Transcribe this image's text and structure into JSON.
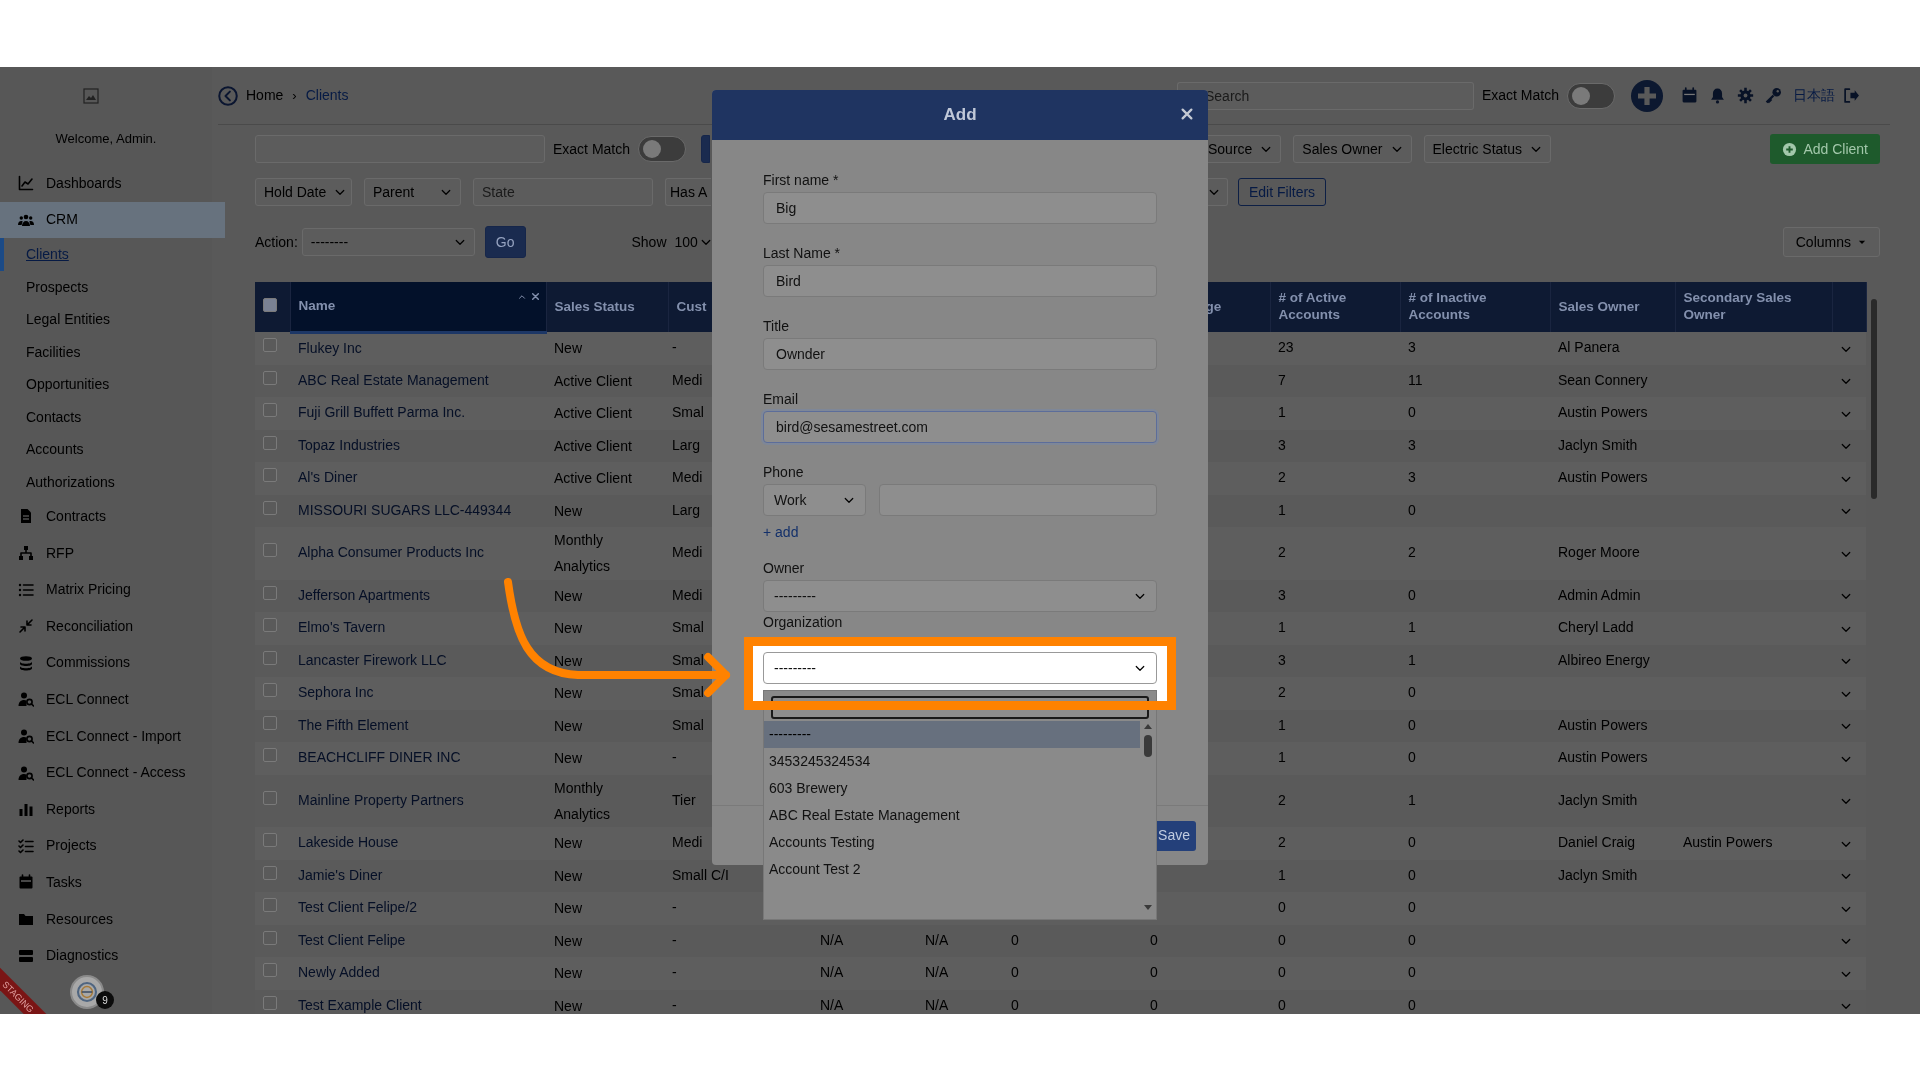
{
  "sidebar": {
    "welcome": "Welcome, Admin.",
    "items": [
      {
        "label": "Dashboards",
        "selected": false
      },
      {
        "label": "CRM",
        "selected": true,
        "children": [
          {
            "label": "Clients",
            "selected": true
          },
          {
            "label": "Prospects",
            "selected": false
          },
          {
            "label": "Legal Entities",
            "selected": false
          },
          {
            "label": "Facilities",
            "selected": false
          },
          {
            "label": "Opportunities",
            "selected": false
          },
          {
            "label": "Contacts",
            "selected": false
          },
          {
            "label": "Accounts",
            "selected": false
          },
          {
            "label": "Authorizations",
            "selected": false
          }
        ]
      },
      {
        "label": "Contracts",
        "selected": false
      },
      {
        "label": "RFP",
        "selected": false
      },
      {
        "label": "Matrix Pricing",
        "selected": false
      },
      {
        "label": "Reconciliation",
        "selected": false
      },
      {
        "label": "Commissions",
        "selected": false
      },
      {
        "label": "ECL Connect",
        "selected": false
      },
      {
        "label": "ECL Connect - Import",
        "selected": false
      },
      {
        "label": "ECL Connect - Access",
        "selected": false
      },
      {
        "label": "Reports",
        "selected": false
      },
      {
        "label": "Projects",
        "selected": false
      },
      {
        "label": "Tasks",
        "selected": false
      },
      {
        "label": "Resources",
        "selected": false
      },
      {
        "label": "Diagnostics",
        "selected": false
      }
    ],
    "widget_badge": "9",
    "ribbon": "STAGING"
  },
  "breadcrumb": {
    "items": [
      "Home",
      "Clients"
    ],
    "separator": "›"
  },
  "topbar": {
    "search_placeholder": "Search",
    "exact_match": {
      "label": "Exact Match",
      "on": false
    },
    "language": "日本語"
  },
  "filters": {
    "exact_match": {
      "label": "Exact Match",
      "on": false
    },
    "selects": [
      "Source",
      "Sales Owner",
      "Electric Status"
    ],
    "add_button": "Add Client",
    "row2_selects": [
      "Hold Date",
      "Parent"
    ],
    "state_placeholder": "State",
    "has_select": "Has A",
    "edit_filters": "Edit Filters",
    "action_label": "Action:",
    "action_value": "--------",
    "go": "Go",
    "show_label": "Show",
    "show_value": "100",
    "columns_button": "Columns"
  },
  "table": {
    "all_checked": false,
    "columns": {
      "name": "Name",
      "sales_status": "Sales Status",
      "column_3": "Cust",
      "column_7": "ge",
      "active_accounts": "# of Active Accounts",
      "inactive_accounts": "# of Inactive Accounts",
      "sales_owner": "Sales Owner",
      "secondary_sales_owner": "Secondary Sales Owner"
    },
    "rows": [
      {
        "checked": false,
        "name": "Flukey Inc",
        "sales_status": "New",
        "column_3": "-",
        "active_accounts": "23",
        "inactive_accounts": "3",
        "sales_owner": "Al Panera"
      },
      {
        "checked": false,
        "name": "ABC Real Estate Management",
        "sales_status": "Active Client",
        "column_3": "Medi",
        "active_accounts": "7",
        "inactive_accounts": "11",
        "sales_owner": "Sean Connery"
      },
      {
        "checked": false,
        "name": "Fuji Grill Buffett Parma Inc.",
        "sales_status": "Active Client",
        "column_3": "Smal",
        "active_accounts": "1",
        "inactive_accounts": "0",
        "sales_owner": "Austin Powers"
      },
      {
        "checked": false,
        "name": "Topaz Industries",
        "sales_status": "Active Client",
        "column_3": "Larg",
        "active_accounts": "3",
        "inactive_accounts": "3",
        "sales_owner": "Jaclyn Smith"
      },
      {
        "checked": false,
        "name": "Al's Diner",
        "sales_status": "Active Client",
        "column_3": "Medi",
        "active_accounts": "2",
        "inactive_accounts": "3",
        "sales_owner": "Austin Powers"
      },
      {
        "checked": false,
        "name": "MISSOURI SUGARS LLC-449344",
        "sales_status": "New",
        "column_3": "Larg",
        "active_accounts": "1",
        "inactive_accounts": "0"
      },
      {
        "checked": false,
        "name": "Alpha Consumer Products Inc",
        "sales_status": "Monthly Analytics",
        "column_3": "Medi",
        "active_accounts": "2",
        "inactive_accounts": "2",
        "sales_owner": "Roger Moore"
      },
      {
        "checked": false,
        "name": "Jefferson Apartments",
        "sales_status": "New",
        "column_3": "Medi",
        "active_accounts": "3",
        "inactive_accounts": "0",
        "sales_owner": "Admin Admin"
      },
      {
        "checked": false,
        "name": "Elmo's Tavern",
        "sales_status": "New",
        "column_3": "Smal",
        "active_accounts": "1",
        "inactive_accounts": "1",
        "sales_owner": "Cheryl Ladd"
      },
      {
        "checked": false,
        "name": "Lancaster Firework LLC",
        "sales_status": "New",
        "column_3": "Smal",
        "active_accounts": "3",
        "inactive_accounts": "1",
        "sales_owner": "Albireo Energy"
      },
      {
        "checked": false,
        "name": "Sephora Inc",
        "sales_status": "New",
        "column_3": "Smal",
        "active_accounts": "2",
        "inactive_accounts": "0"
      },
      {
        "checked": false,
        "name": "The Fifth Element",
        "sales_status": "New",
        "column_3": "Smal",
        "active_accounts": "1",
        "inactive_accounts": "0",
        "sales_owner": "Austin Powers"
      },
      {
        "checked": false,
        "name": "BEACHCLIFF DINER INC",
        "sales_status": "New",
        "column_3": "-",
        "active_accounts": "1",
        "inactive_accounts": "0",
        "sales_owner": "Austin Powers"
      },
      {
        "checked": false,
        "name": "Mainline Property Partners",
        "sales_status": "Monthly Analytics",
        "column_3": "Tier",
        "active_accounts": "2",
        "inactive_accounts": "1",
        "sales_owner": "Jaclyn Smith"
      },
      {
        "checked": false,
        "name": "Lakeside House",
        "sales_status": "New",
        "column_3": "Medi",
        "active_accounts": "2",
        "inactive_accounts": "0",
        "sales_owner": "Daniel Craig",
        "secondary_sales_owner": "Austin Powers"
      },
      {
        "checked": false,
        "name": "Jamie's Diner",
        "sales_status": "New",
        "column_3": "Small C/I",
        "active_accounts": "1",
        "inactive_accounts": "0",
        "sales_owner": "Jaclyn Smith"
      },
      {
        "checked": false,
        "name": "Test Client Felipe/2",
        "sales_status": "New",
        "column_3": "-",
        "active_accounts": "0",
        "inactive_accounts": "0"
      },
      {
        "checked": false,
        "name": "Test Client Felipe",
        "sales_status": "New",
        "column_3": "-",
        "column_4": "N/A",
        "column_5": "N/A",
        "column_6": "0",
        "column_7": "0",
        "active_accounts": "0",
        "inactive_accounts": "0"
      },
      {
        "checked": false,
        "name": "Newly Added",
        "sales_status": "New",
        "column_3": "-",
        "column_4": "N/A",
        "column_5": "N/A",
        "column_6": "0",
        "column_7": "0",
        "active_accounts": "0",
        "inactive_accounts": "0"
      },
      {
        "checked": false,
        "name": "Test Example Client",
        "sales_status": "New",
        "column_3": "-",
        "column_4": "N/A",
        "column_5": "N/A",
        "column_6": "0",
        "column_7": "0",
        "active_accounts": "0",
        "inactive_accounts": "0"
      }
    ]
  },
  "modal": {
    "title": "Add",
    "fields": [
      {
        "kind": "input",
        "label": "First name *",
        "value": "Big",
        "focused": false
      },
      {
        "kind": "input",
        "label": "Last Name *",
        "value": "Bird",
        "focused": false
      },
      {
        "kind": "input",
        "label": "Title",
        "value": "Ownder",
        "focused": false
      },
      {
        "kind": "input",
        "label": "Email",
        "value": "bird@sesamestreet.com",
        "focused": true
      },
      {
        "kind": "phone",
        "label": "Phone",
        "type": "Work",
        "add_link": "+ add"
      },
      {
        "kind": "select",
        "label": "Owner",
        "value": "---------",
        "open": false
      },
      {
        "kind": "select",
        "label": "Organization",
        "value": "---------",
        "open": true
      }
    ],
    "save": "Save",
    "options": [
      {
        "label": "---------",
        "selected": true
      },
      {
        "label": "3453245324534",
        "selected": false
      },
      {
        "label": "603 Brewery",
        "selected": false
      },
      {
        "label": "ABC Real Estate Management",
        "selected": false
      },
      {
        "label": "Accounts Testing",
        "selected": false
      },
      {
        "label": "Account Test 2",
        "selected": false
      }
    ]
  },
  "annotations": {
    "highlight_frame": true,
    "pointer_arrow": true
  }
}
